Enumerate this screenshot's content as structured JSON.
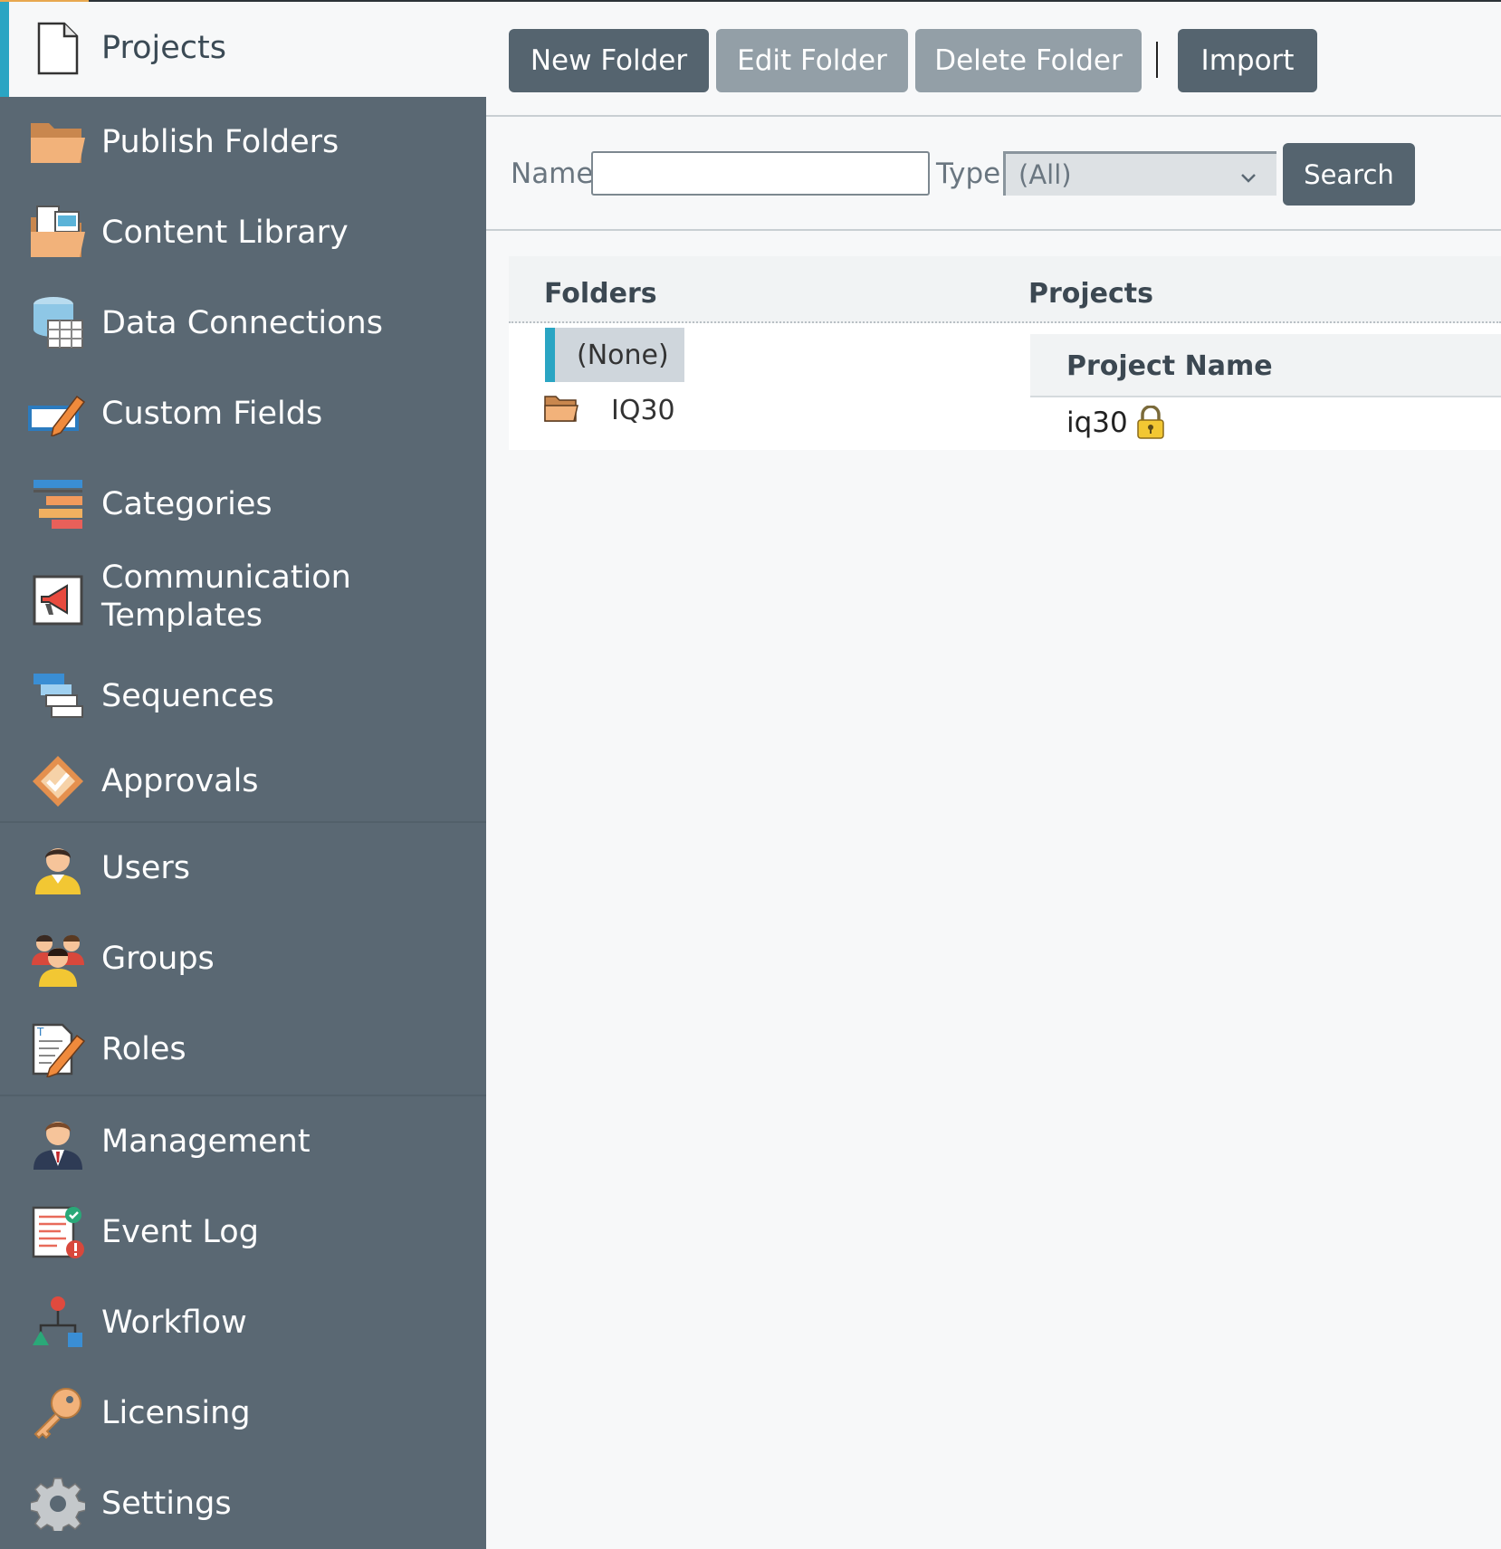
{
  "sidebar": {
    "items": [
      {
        "label": "Projects",
        "icon": "document-icon"
      },
      {
        "label": "Publish Folders",
        "icon": "folder-icon"
      },
      {
        "label": "Content Library",
        "icon": "content-library-icon"
      },
      {
        "label": "Data Connections",
        "icon": "database-icon"
      },
      {
        "label": "Custom Fields",
        "icon": "pencil-field-icon"
      },
      {
        "label": "Categories",
        "icon": "categories-icon"
      },
      {
        "label": "Communication Templates",
        "label_line1": "Communication",
        "label_line2": "Templates",
        "icon": "megaphone-icon"
      },
      {
        "label": "Sequences",
        "icon": "sequences-icon"
      },
      {
        "label": "Approvals",
        "icon": "approval-check-icon"
      },
      {
        "label": "Users",
        "icon": "user-icon"
      },
      {
        "label": "Groups",
        "icon": "group-icon"
      },
      {
        "label": "Roles",
        "icon": "roles-edit-icon"
      },
      {
        "label": "Management",
        "icon": "manager-icon"
      },
      {
        "label": "Event Log",
        "icon": "event-log-icon"
      },
      {
        "label": "Workflow",
        "icon": "workflow-icon"
      },
      {
        "label": "Licensing",
        "icon": "key-icon"
      },
      {
        "label": "Settings",
        "icon": "gear-icon"
      }
    ]
  },
  "toolbar": {
    "new_folder": "New Folder",
    "edit_folder": "Edit Folder",
    "delete_folder": "Delete Folder",
    "import": "Import"
  },
  "search": {
    "name_label": "Name",
    "name_value": "",
    "type_label": "Type",
    "type_selected": "(All)",
    "search_button": "Search"
  },
  "content": {
    "folders_header": "Folders",
    "projects_header": "Projects",
    "folders": [
      {
        "name": "(None)",
        "selected": true
      },
      {
        "name": "IQ30",
        "selected": false
      }
    ],
    "project_table": {
      "column": "Project Name",
      "rows": [
        {
          "name": "iq30",
          "locked": true
        }
      ]
    }
  },
  "colors": {
    "sidebar_bg": "#5a6873",
    "accent": "#2aa5c3",
    "button": "#55646f",
    "button_disabled": "#939fa7"
  }
}
